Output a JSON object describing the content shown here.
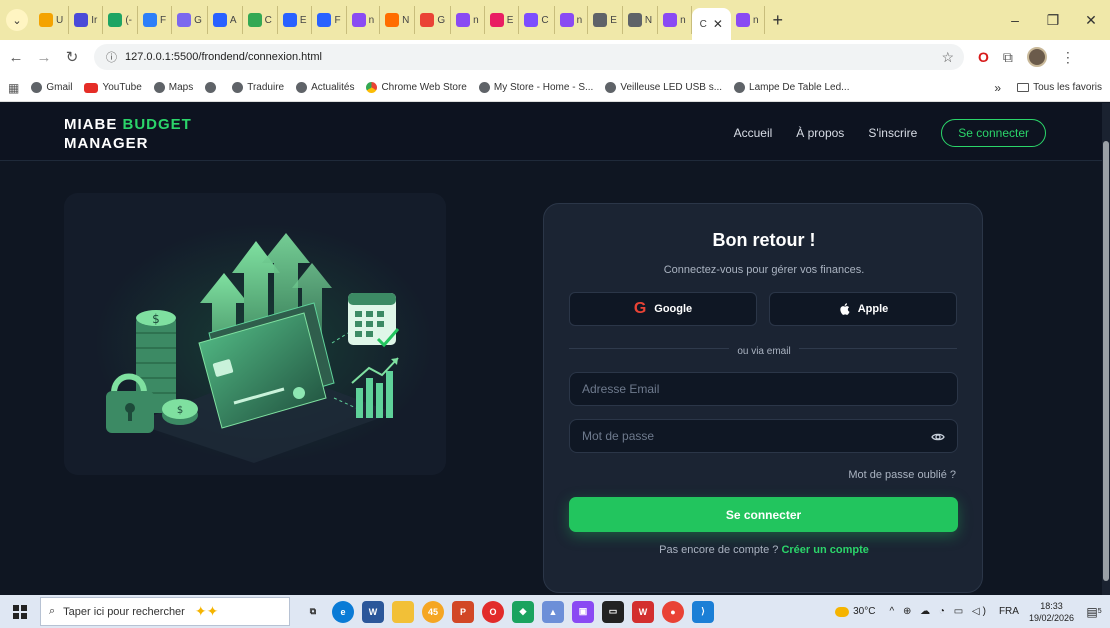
{
  "browser": {
    "tabs": [
      {
        "label": "U",
        "color": "#f4a300"
      },
      {
        "label": "Ir",
        "color": "#4a4ad8"
      },
      {
        "label": "(-",
        "color": "#1fa463"
      },
      {
        "label": "F",
        "color": "#2d7ff9"
      },
      {
        "label": "G",
        "color": "#7b68ee"
      },
      {
        "label": "A",
        "color": "#2962ff"
      },
      {
        "label": "C",
        "color": "#34a853"
      },
      {
        "label": "E",
        "color": "#2962ff"
      },
      {
        "label": "F",
        "color": "#2962ff"
      },
      {
        "label": "n",
        "color": "#8a4af3"
      },
      {
        "label": "N",
        "color": "#ff6d00"
      },
      {
        "label": "G",
        "color": "#ea4335"
      },
      {
        "label": "n",
        "color": "#8a4af3"
      },
      {
        "label": "E",
        "color": "#e91e63"
      },
      {
        "label": "C",
        "color": "#7c4dff"
      },
      {
        "label": "n",
        "color": "#8a4af3"
      },
      {
        "label": "E",
        "color": "#5f6368"
      },
      {
        "label": "N",
        "color": "#5f6368"
      },
      {
        "label": "n",
        "color": "#8a4af3"
      }
    ],
    "active_tab": {
      "label": "C"
    },
    "trailing_tab": {
      "label": "n",
      "color": "#8a4af3"
    },
    "new_tab": "+",
    "url": "127.0.0.1:5500/frondend/connexion.html",
    "bookmarks": [
      {
        "label": "Gmail",
        "icon": "globe"
      },
      {
        "label": "YouTube",
        "icon": "yt"
      },
      {
        "label": "Maps",
        "icon": "globe"
      },
      {
        "label": "",
        "icon": "globe"
      },
      {
        "label": "Traduire",
        "icon": "globe"
      },
      {
        "label": "Actualités",
        "icon": "globe"
      },
      {
        "label": "Chrome Web Store",
        "icon": "cws"
      },
      {
        "label": "My Store - Home - S...",
        "icon": "globe"
      },
      {
        "label": "Veilleuse LED USB s...",
        "icon": "globe"
      },
      {
        "label": "Lampe De Table Led...",
        "icon": "globe"
      }
    ],
    "bookmarks_more": "»",
    "all_bookmarks": "Tous les favoris"
  },
  "site": {
    "brand_part1": "MIABE ",
    "brand_part2": "BUDGET",
    "brand_part3": "MANAGER",
    "nav": {
      "home": "Accueil",
      "about": "À propos",
      "signup": "S'inscrire",
      "login": "Se connecter"
    }
  },
  "login": {
    "title": "Bon retour !",
    "subtitle": "Connectez-vous pour gérer vos finances.",
    "google": "Google",
    "apple": "Apple",
    "divider": "ou via email",
    "email_placeholder": "Adresse Email",
    "password_placeholder": "Mot de passe",
    "forgot": "Mot de passe oublié ?",
    "submit": "Se connecter",
    "no_account": "Pas encore de compte ? ",
    "create_account": "Créer un compte"
  },
  "taskbar": {
    "search_placeholder": "Taper ici pour rechercher",
    "badge_count": "45",
    "temperature": "30°C",
    "language": "FRA",
    "time": "18:33",
    "date": "19/02/2026",
    "notifications": "5"
  },
  "colors": {
    "accent": "#22c55e",
    "page_bg": "#0f1622",
    "card_bg": "#1b2433"
  }
}
